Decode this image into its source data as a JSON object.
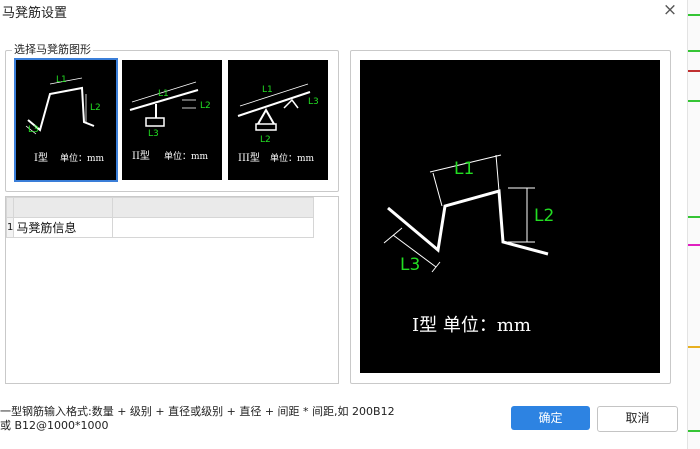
{
  "window": {
    "title": "马凳筋设置",
    "close_label": "×"
  },
  "shape_group": {
    "label": "选择马凳筋图形",
    "shapes": [
      {
        "name": "I型",
        "unit": "单位：mm",
        "labels": [
          "L1",
          "L2",
          "L3"
        ],
        "selected": true
      },
      {
        "name": "II型",
        "unit": "单位：mm",
        "labels": [
          "L1",
          "L2",
          "L3"
        ],
        "selected": false
      },
      {
        "name": "III型",
        "unit": "单位：mm",
        "labels": [
          "L1",
          "L2",
          "L3"
        ],
        "selected": false
      }
    ]
  },
  "grid": {
    "headers": [
      "",
      ""
    ],
    "rows": [
      {
        "num": "1",
        "name": "马凳筋信息",
        "value": ""
      }
    ]
  },
  "preview": {
    "labels": [
      "L1",
      "L2",
      "L3"
    ],
    "caption": "I型 单位：mm"
  },
  "footer": {
    "note_line1": "一型钢筋输入格式:数量 + 级别 + 直径或级别 + 直径 + 间距 * 间距,如 200B12",
    "note_line2": "或 B12@1000*1000",
    "ok_label": "确定",
    "cancel_label": "取消"
  },
  "colors": {
    "accent": "#2d83e2",
    "label_green": "#22dd22",
    "drawing_bg": "#000000"
  }
}
